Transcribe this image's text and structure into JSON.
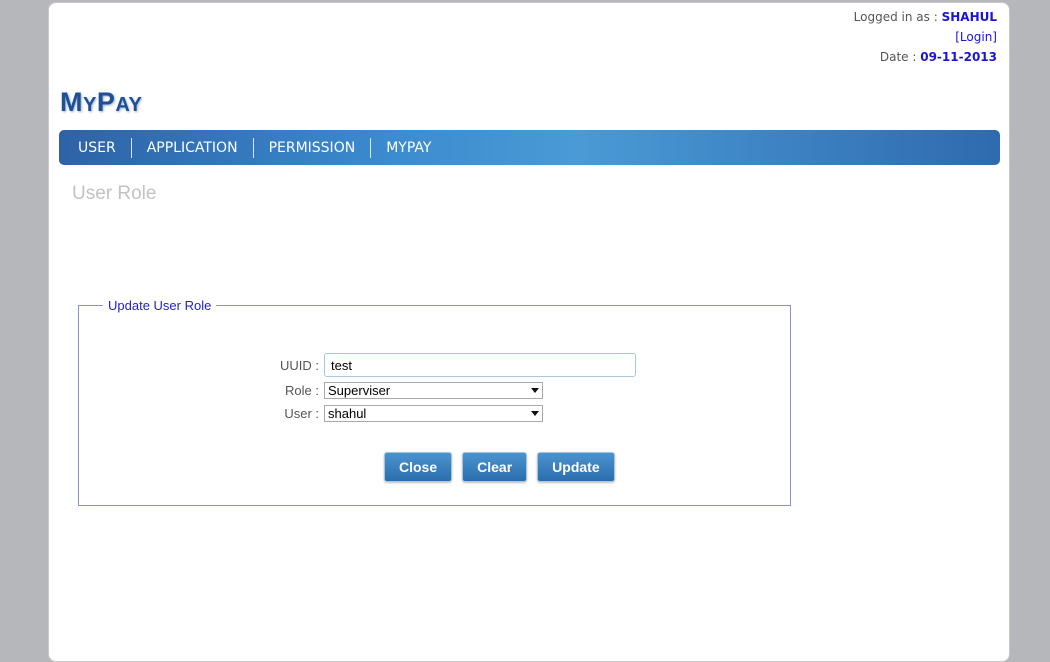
{
  "header": {
    "logged_in_label": "Logged in as :",
    "username": "SHAHUL",
    "login_link": "[Login]",
    "date_label": "Date :",
    "date_value": "09-11-2013"
  },
  "logo": {
    "first_cap": "M",
    "first_rest": "Y",
    "second_cap": "P",
    "second_rest": "AY"
  },
  "nav": {
    "items": [
      "USER",
      "APPLICATION",
      "PERMISSION",
      "MYPAY"
    ]
  },
  "page": {
    "title": "User Role"
  },
  "form": {
    "legend": "Update User Role",
    "uuid_label": "UUID :",
    "uuid_value": "test",
    "role_label": "Role :",
    "role_value": "Superviser",
    "user_label": "User :",
    "user_value": "shahul",
    "buttons": {
      "close": "Close",
      "clear": "Clear",
      "update": "Update"
    }
  },
  "colors": {
    "accent": "#2e6fb0",
    "link": "#1a14d6"
  }
}
